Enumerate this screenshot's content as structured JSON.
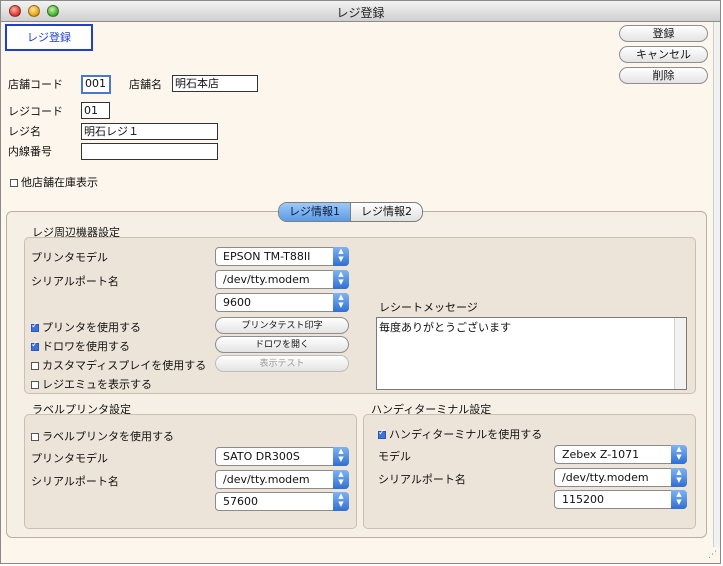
{
  "window": {
    "title": "レジ登録"
  },
  "header": {
    "badge": "レジ登録"
  },
  "actions": {
    "register": "登録",
    "cancel": "キャンセル",
    "delete": "削除"
  },
  "store": {
    "code_label": "店舗コード",
    "code_value": "001",
    "name_label": "店舗名",
    "name_value": "明石本店"
  },
  "register": {
    "code_label": "レジコード",
    "code_value": "01",
    "name_label": "レジ名",
    "name_value": "明石レジ１",
    "ext_label": "内線番号",
    "ext_value": ""
  },
  "other_stock": {
    "label": "他店舗在庫表示",
    "checked": false
  },
  "tabs": [
    {
      "label": "レジ情報1",
      "active": true
    },
    {
      "label": "レジ情報2",
      "active": false
    }
  ],
  "peripherals": {
    "title": "レジ周辺機器設定",
    "printer_model_label": "プリンタモデル",
    "printer_model": "EPSON TM-T88II",
    "serial_port_label": "シリアルポート名",
    "serial_port": "/dev/tty.modem",
    "baud": "9600",
    "use_printer": {
      "label": "プリンタを使用する",
      "checked": true
    },
    "use_drawer": {
      "label": "ドロワを使用する",
      "checked": true
    },
    "use_display": {
      "label": "カスタマディスプレイを使用する",
      "checked": false
    },
    "show_emulator": {
      "label": "レジエミュを表示する",
      "checked": false
    },
    "print_test_button": "プリンタテスト印字",
    "open_drawer_button": "ドロワを開く",
    "display_test_button": "表示テスト",
    "receipt_message_label": "レシートメッセージ",
    "receipt_message": "毎度ありがとうございます"
  },
  "label_printer": {
    "title": "ラベルプリンタ設定",
    "use": {
      "label": "ラベルプリンタを使用する",
      "checked": false
    },
    "model_label": "プリンタモデル",
    "model": "SATO DR300S",
    "port_label": "シリアルポート名",
    "port": "/dev/tty.modem",
    "baud": "57600"
  },
  "handy": {
    "title": "ハンディターミナル設定",
    "use": {
      "label": "ハンディターミナルを使用する",
      "checked": true
    },
    "model_label": "モデル",
    "model": "Zebex Z-1071",
    "port_label": "シリアルポート名",
    "port": "/dev/tty.modem",
    "baud": "115200"
  }
}
